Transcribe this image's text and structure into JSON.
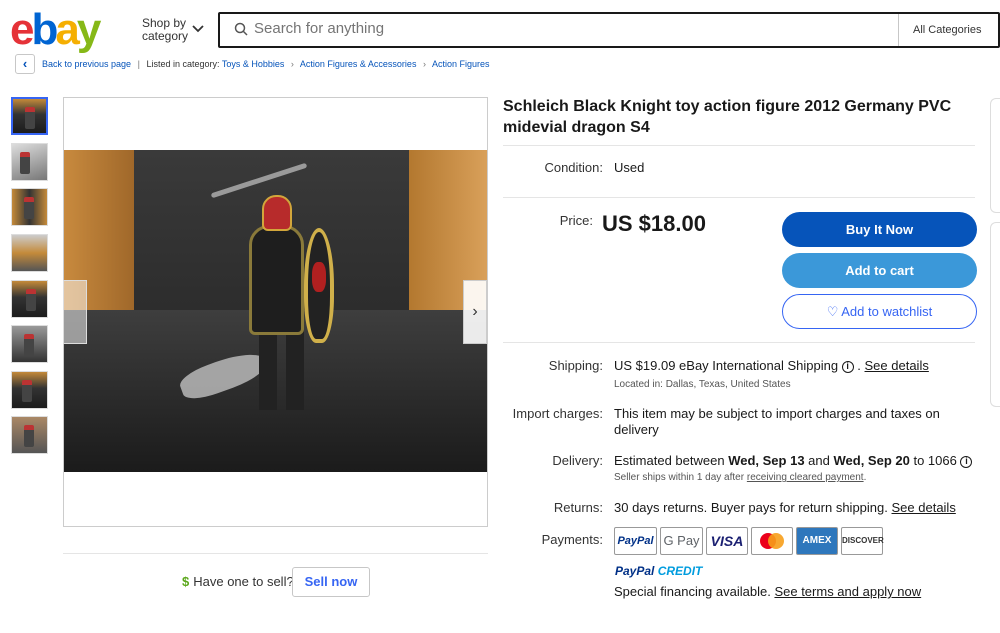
{
  "header": {
    "logo_letters": [
      "e",
      "b",
      "a",
      "y"
    ],
    "shop_by_line1": "Shop by",
    "shop_by_line2": "category",
    "search_placeholder": "Search for anything",
    "category_select": "All Categories"
  },
  "breadcrumb": {
    "back_label": "Back to previous page",
    "listed_in": "Listed in category:",
    "items": [
      "Toys & Hobbies",
      "Action Figures & Accessories",
      "Action Figures"
    ]
  },
  "gallery": {
    "thumbnail_count": 8,
    "active_index": 0
  },
  "sell": {
    "question": "Have one to sell?",
    "button": "Sell now"
  },
  "listing": {
    "title": "Schleich Black Knight toy action figure 2012 Germany PVC midevial dragon S4",
    "condition_label": "Condition:",
    "condition_value": "Used",
    "price_label": "Price:",
    "price_value": "US $18.00",
    "buy_now": "Buy It Now",
    "add_to_cart": "Add to cart",
    "add_to_watchlist": "Add to watchlist"
  },
  "shipping": {
    "label": "Shipping:",
    "value": "US $19.09 eBay International Shipping",
    "see_details": "See details",
    "located": "Located in: Dallas, Texas, United States"
  },
  "import": {
    "label": "Import charges:",
    "value": "This item may be subject to import charges and taxes on delivery"
  },
  "delivery": {
    "label": "Delivery:",
    "prefix": "Estimated between",
    "date1": "Wed, Sep 13",
    "and": "and",
    "date2": "Wed, Sep 20",
    "suffix": "to 1066",
    "ships_prefix": "Seller ships within 1 day after",
    "ships_link": "receiving cleared payment",
    "ships_suffix": "."
  },
  "returns": {
    "label": "Returns:",
    "value": "30 days returns. Buyer pays for return shipping.",
    "see_details": "See details"
  },
  "payments": {
    "label": "Payments:",
    "methods": [
      "PayPal",
      "G Pay",
      "VISA",
      "",
      "AMEX",
      "DISCOVER"
    ],
    "paypal_credit_1": "PayPal",
    "paypal_credit_2": "CREDIT",
    "financing_text": "Special financing available.",
    "financing_link": "See terms and apply now"
  },
  "colors": {
    "buy_now_bg": "#0654ba",
    "add_to_cart_bg": "#3b98d9",
    "link_blue": "#0654ba",
    "accent": "#3665f3"
  }
}
